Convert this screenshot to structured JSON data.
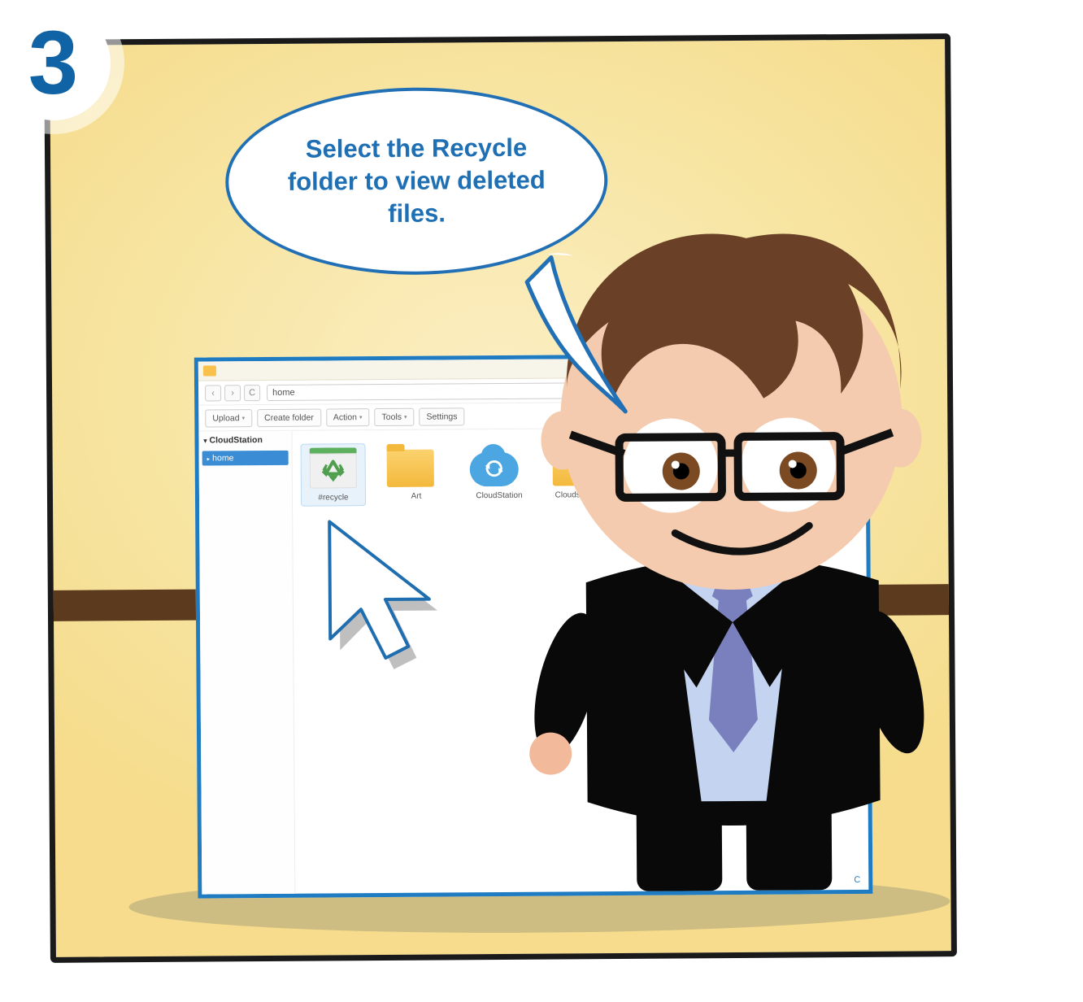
{
  "step_number": "3",
  "speech_text": "Select the Recycle folder to view deleted files.",
  "colors": {
    "accent": "#1f7bc2",
    "text_accent": "#1e6fb3",
    "panel_bg": "#f9e6a5"
  },
  "window": {
    "path_value": "home",
    "toolbar": {
      "upload_label": "Upload",
      "create_folder_label": "Create folder",
      "action_label": "Action",
      "tools_label": "Tools",
      "settings_label": "Settings"
    },
    "sidebar": {
      "root_label": "CloudStation",
      "items": [
        {
          "label": "home"
        }
      ]
    },
    "items": [
      {
        "label": "#recycle",
        "type": "recycle",
        "selected": true
      },
      {
        "label": "Art",
        "type": "folder",
        "selected": false
      },
      {
        "label": "CloudStation",
        "type": "cloud",
        "selected": false
      },
      {
        "label": "Cloudstation Fi",
        "type": "folder",
        "selected": false
      }
    ]
  }
}
